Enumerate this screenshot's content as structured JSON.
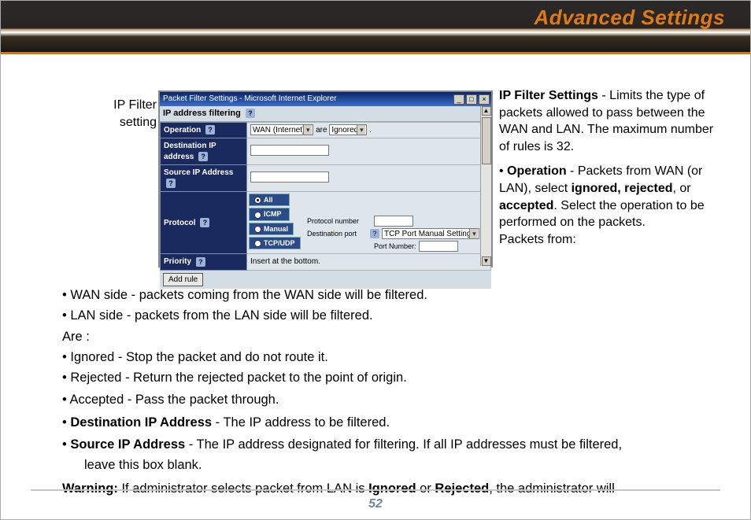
{
  "page": {
    "title": "Advanced Settings",
    "number": "52",
    "side_label": "IP Filter setting"
  },
  "screenshot": {
    "window_title": "Packet Filter Settings - Microsoft Internet Explorer",
    "section_title": "IP address filtering",
    "help_glyph": "?",
    "rows": {
      "operation": {
        "label": "Operation",
        "select1": "WAN (Internet)",
        "mid": "are",
        "select2": "Ignored",
        "tail": "."
      },
      "dest_ip": {
        "label": "Destination IP address"
      },
      "src_ip": {
        "label": "Source IP Address"
      },
      "protocol": {
        "label": "Protocol",
        "opts": {
          "all": "All",
          "icmp": "ICMP",
          "manual": "Manual",
          "tcpudp": "TCP/UDP"
        },
        "pn_label": "Protocol number",
        "dp_label": "Destination port",
        "dp_select": "TCP Port Manual Setting",
        "pn2_label": "Port Number:"
      },
      "priority": {
        "label": "Priority",
        "value": "Insert at the bottom."
      }
    },
    "add_btn": "Add rule",
    "win_btns": {
      "min": "_",
      "max": "□",
      "close": "×"
    },
    "scroll": {
      "up": "▲",
      "down": "▼"
    }
  },
  "right": {
    "p1_b": "IP Filter Settings",
    "p1": " - Limits the type of packets allowed to pass between the WAN and LAN. The maximum number of rules is 32.",
    "p2_pre": "• ",
    "p2_b1": "Operation",
    "p2_m1": " - Packets from WAN (or LAN), select ",
    "p2_b2": "ignored, rejected",
    "p2_m2": ", or ",
    "p2_b3": "accepted",
    "p2_m3": ".  Select the operation to be performed on the packets.",
    "p2_tail": "Packets from:"
  },
  "body": {
    "l1": "• WAN side - packets coming from the WAN side will be filtered.",
    "l2": "• LAN side - packets from the LAN side will be filtered.",
    "l3": "Are :",
    "l4": "• Ignored - Stop the packet and do not route it.",
    "l5": "• Rejected - Return the rejected packet to the point of origin.",
    "l6": "•  Accepted - Pass the packet through.",
    "l7_pre": "• ",
    "l7_b": "Destination IP Address",
    "l7_post": " - The IP address to be filtered.",
    "l8_pre": "• ",
    "l8_b": "Source IP Address",
    "l8_post": " - The IP address designated for filtering. If all IP addresses must be filtered,",
    "l8_cont": "leave this box blank.",
    "l9_b": "Warning:",
    "l9_m1": " If administrator selects packet from LAN is ",
    "l9_b2": "Ignored",
    "l9_m2": " or ",
    "l9_b3": "Rejected",
    "l9_m3": ", the administrator will"
  }
}
